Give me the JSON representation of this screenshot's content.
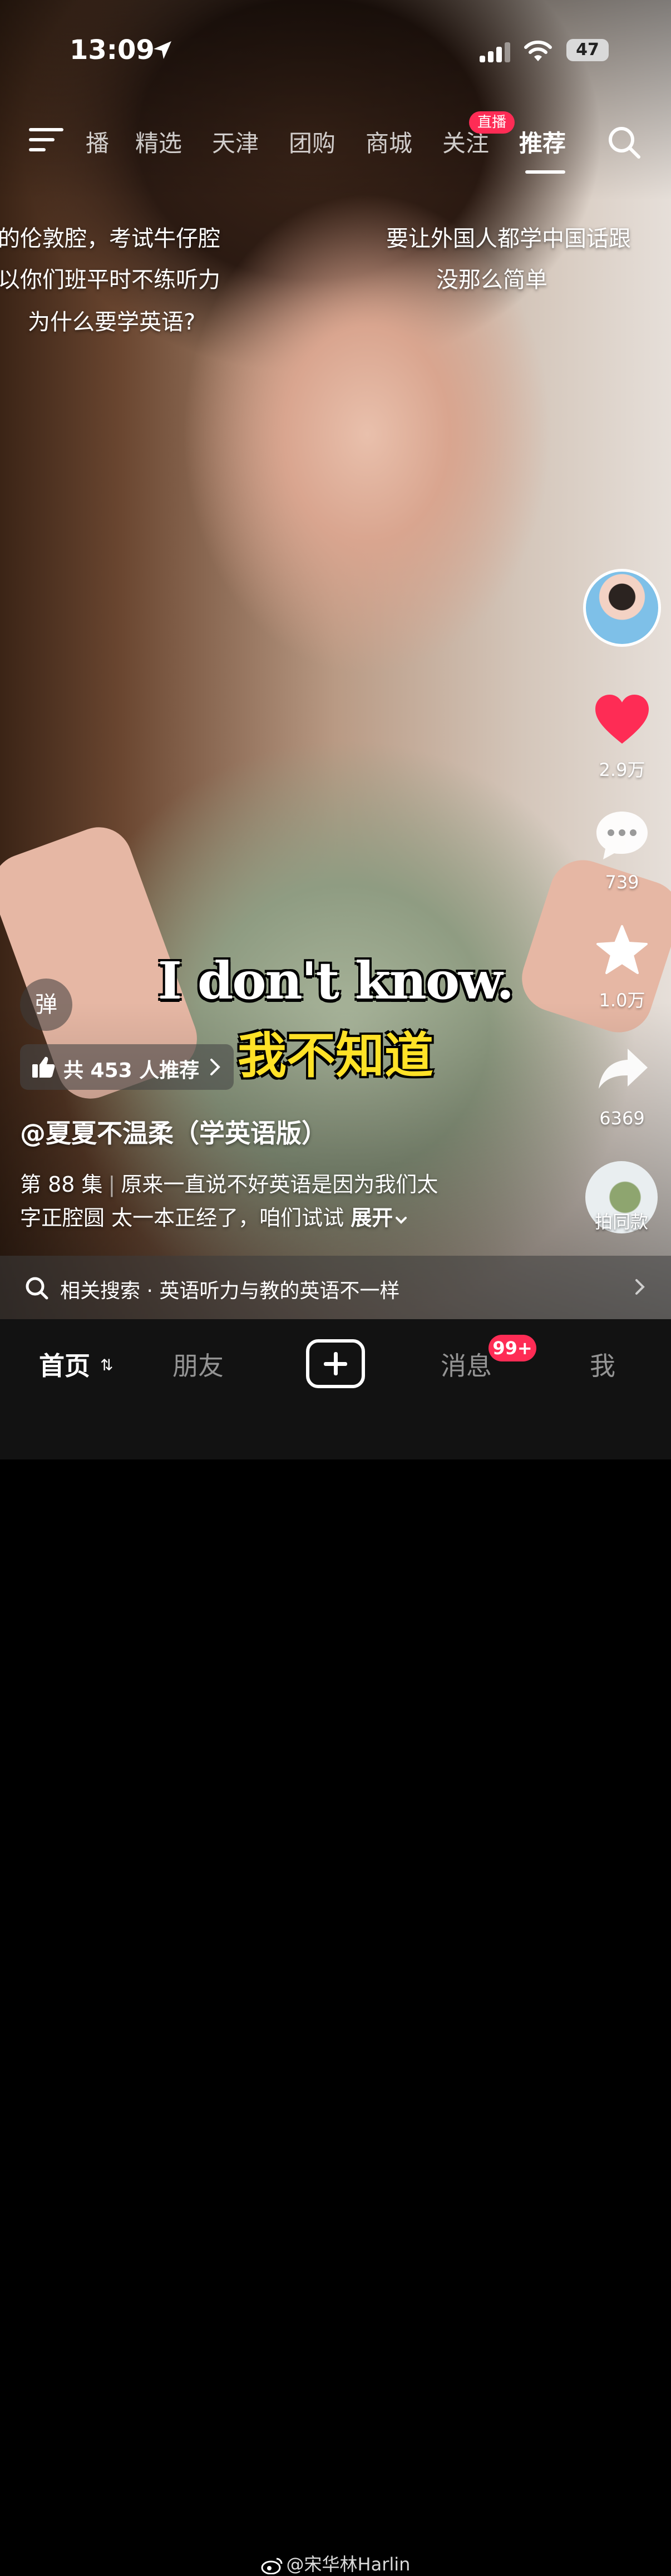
{
  "status_bar": {
    "time": "13:09",
    "battery": "47"
  },
  "top_nav": {
    "tabs": [
      "播",
      "精选",
      "天津",
      "团购",
      "商城",
      "关注",
      "推荐"
    ],
    "active_tab": "推荐",
    "live_badge": "直播"
  },
  "danmaku_comments": [
    "的伦敦腔，考试牛仔腔",
    "以你们班平时不练听力",
    "为什么要学英语?",
    "要让外国人都学中国话跟",
    "没那么简单"
  ],
  "actions": {
    "likes": "2.9万",
    "comments": "739",
    "favorites": "1.0万",
    "shares": "6369",
    "music_label": "拍同款"
  },
  "subtitles": {
    "english": "I don't know.",
    "chinese": "我不知道"
  },
  "danmaku_toggle": "弹",
  "recommend": {
    "label": "共 453 人推荐"
  },
  "author": "@夏夏不温柔（学英语版）",
  "description": {
    "episode": "第 88 集",
    "line1": "原来一直说不好英语是因为我们太",
    "line2": "字正腔圆 太一本正经了，咱们试试",
    "more": "展开"
  },
  "related_search": {
    "label": "相关搜索 · 英语听力与教的英语不一样"
  },
  "bottom_nav": {
    "home": "首页",
    "friends": "朋友",
    "messages": "消息",
    "messages_badge": "99+",
    "me": "我"
  },
  "watermark": "@宋华林Harlin",
  "colors": {
    "accent": "#fe2c55",
    "subtitle_cn": "#ffe227"
  }
}
